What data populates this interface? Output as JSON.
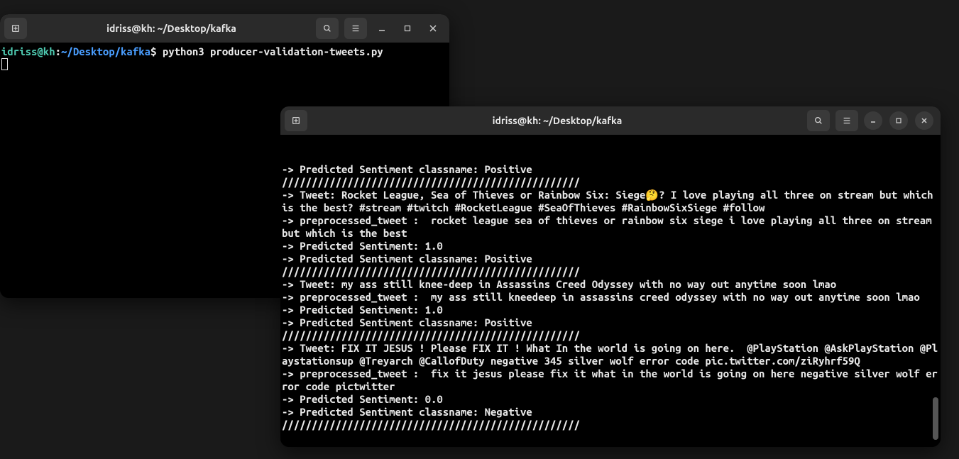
{
  "win1": {
    "title": "idriss@kh: ~/Desktop/kafka",
    "prompt_user": "idriss@kh",
    "prompt_colon": ":",
    "prompt_path": "~/Desktop/kafka",
    "prompt_symbol": "$",
    "command": " python3 producer-validation-tweets.py"
  },
  "win2": {
    "title": "idriss@kh: ~/Desktop/kafka",
    "lines": [
      "-> Predicted Sentiment classname: Positive",
      "//////////////////////////////////////////////////",
      "-> Tweet: Rocket League, Sea of Thieves or Rainbow Six: Siege🤔? I love playing all three on stream but which is the best? #stream #twitch #RocketLeague #SeaOfThieves #RainbowSixSiege #follow",
      "-> preprocessed_tweet :  rocket league sea of thieves or rainbow six siege i love playing all three on stream but which is the best",
      "-> Predicted Sentiment: 1.0",
      "-> Predicted Sentiment classname: Positive",
      "//////////////////////////////////////////////////",
      "-> Tweet: my ass still knee-deep in Assassins Creed Odyssey with no way out anytime soon lmao",
      "-> preprocessed_tweet :  my ass still kneedeep in assassins creed odyssey with no way out anytime soon lmao",
      "-> Predicted Sentiment: 1.0",
      "-> Predicted Sentiment classname: Positive",
      "//////////////////////////////////////////////////",
      "-> Tweet: FIX IT JESUS ! Please FIX IT ! What In the world is going on here.  @PlayStation @AskPlayStation @Playstationsup @Treyarch @CallofDuty negative 345 silver wolf error code pic.twitter.com/ziRyhrf59Q",
      "-> preprocessed_tweet :  fix it jesus please fix it what in the world is going on here negative silver wolf error code pictwitter",
      "-> Predicted Sentiment: 0.0",
      "-> Predicted Sentiment classname: Negative",
      "//////////////////////////////////////////////////"
    ]
  }
}
